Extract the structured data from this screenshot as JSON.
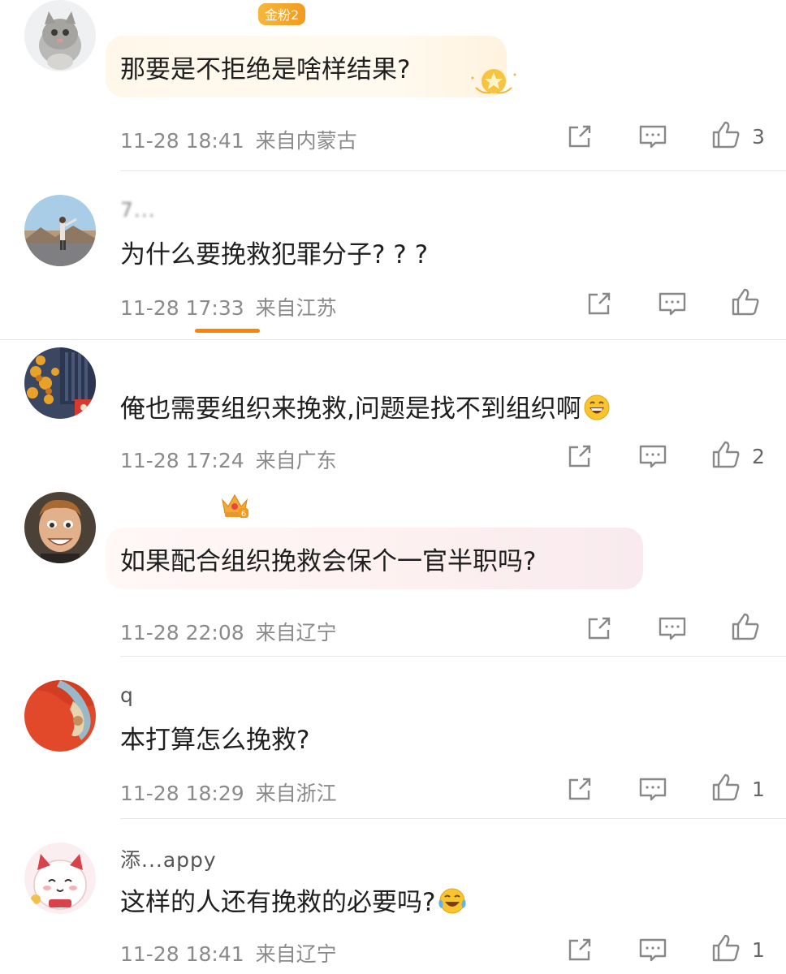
{
  "comments": [
    {
      "username": "",
      "badge": "金粉2",
      "text": "那要是不拒绝是啥样结果?",
      "time": "11-28 18:41",
      "location": "来自内蒙古",
      "likes": "3"
    },
    {
      "username": "7...",
      "text": "为什么要挽救犯罪分子? ? ?",
      "time": "11-28 17:33",
      "location": "来自江苏",
      "likes": ""
    },
    {
      "username": "",
      "text": "俺也需要组织来挽救,问题是找不到组织啊",
      "time": "11-28 17:24",
      "location": "来自广东",
      "likes": "2"
    },
    {
      "username": "",
      "badge_level": "6",
      "text": "如果配合组织挽救会保个一官半职吗?",
      "time": "11-28 22:08",
      "location": "来自辽宁",
      "likes": ""
    },
    {
      "username": "q",
      "text": "本打算怎么挽救?",
      "time": "11-28 18:29",
      "location": "来自浙江",
      "likes": "1"
    },
    {
      "username": "添...appy",
      "text": "这样的人还有挽救的必要吗?",
      "time": "11-28 18:41",
      "location": "来自辽宁",
      "likes": "1"
    }
  ],
  "icons": {
    "share": "share-icon",
    "reply": "comment-icon",
    "like": "thumbs-up-icon"
  },
  "colors": {
    "accent": "#ff8200",
    "meta_text": "#8a8a8a",
    "badge": "#f6b73c"
  }
}
